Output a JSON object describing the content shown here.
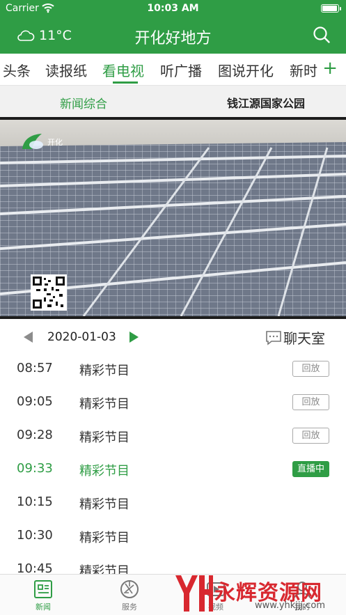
{
  "status_bar": {
    "carrier": "Carrier",
    "time": "10:03 AM",
    "battery_level": 0.95
  },
  "header": {
    "temperature": "11°C",
    "title": "开化好地方",
    "weather_icon": "cloud-icon",
    "search_icon": "search-icon"
  },
  "tabs": {
    "items": [
      {
        "label": "头条"
      },
      {
        "label": "读报纸"
      },
      {
        "label": "看电视",
        "active": true
      },
      {
        "label": "听广播"
      },
      {
        "label": "图说开化"
      },
      {
        "label": "新时"
      }
    ],
    "more_label": "+"
  },
  "subtabs": {
    "items": [
      {
        "label": "新闻综合",
        "active": true
      },
      {
        "label": "钱江源国家公园"
      }
    ]
  },
  "video": {
    "logo_text": "开化"
  },
  "schedule": {
    "date": "2020-01-03",
    "chat_label": "聊天室",
    "items": [
      {
        "time": "08:57",
        "title": "精彩节目",
        "status": "回放"
      },
      {
        "time": "09:05",
        "title": "精彩节目",
        "status": "回放"
      },
      {
        "time": "09:28",
        "title": "精彩节目",
        "status": "回放"
      },
      {
        "time": "09:33",
        "title": "精彩节目",
        "status": "直播中",
        "live": true
      },
      {
        "time": "10:15",
        "title": "精彩节目"
      },
      {
        "time": "10:30",
        "title": "精彩节目"
      },
      {
        "time": "10:45",
        "title": "精彩节目"
      }
    ]
  },
  "bottom_nav": {
    "items": [
      {
        "label": "新闻",
        "icon": "news-icon",
        "active": true
      },
      {
        "label": "服务",
        "icon": "aperture-icon"
      },
      {
        "label": "视频",
        "icon": "video-icon"
      },
      {
        "label": "我的",
        "icon": "profile-icon"
      }
    ]
  },
  "watermark": {
    "brand": "永辉资源网",
    "url": "www.yhkjjj.com"
  },
  "colors": {
    "primary": "#2f9d45",
    "live_badge": "#2f9d45",
    "watermark": "#d8282f"
  }
}
